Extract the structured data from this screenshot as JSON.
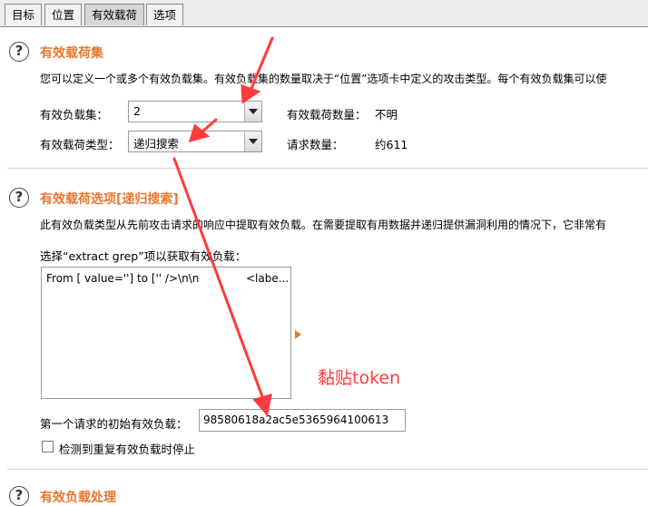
{
  "tabs": [
    {
      "label": "目标"
    },
    {
      "label": "位置"
    },
    {
      "label": "有效载荷"
    },
    {
      "label": "选项"
    }
  ],
  "section1": {
    "title": "有效载荷集",
    "description": "您可以定义一个或多个有效负载集。有效负载集的数量取决于“位置”选项卡中定义的攻击类型。每个有效负载集可以使",
    "payload_set_label": "有效负载集：",
    "payload_set_value": "2",
    "payload_type_label": "有效载荷类型：",
    "payload_type_value": "递归搜索",
    "payload_count_label": "有效载荷数量：",
    "payload_count_value": "不明",
    "request_count_label": "请求数量：",
    "request_count_value": "约611"
  },
  "section2": {
    "title": "有效载荷选项[递归搜索]",
    "description": "此有效负载类型从先前攻击请求的响应中提取有效负载。在需要提取有用数据并递归提供漏洞利用的情况下，它非常有",
    "extract_label": "选择“extract grep”项以获取有效负载：",
    "list_items": [
      {
        "text": "From [ value=''] to ['' />\\n\\n",
        "extra": "<labe..."
      }
    ],
    "initial_payload_label": "第一个请求的初始有效负载：",
    "initial_payload_value": "98580618a2ac5e5365964100613",
    "stop_duplicate_label": "检测到重复有效负载时停止"
  },
  "section3": {
    "title": "有效负载处理"
  },
  "annotation": {
    "text": "黏贴token",
    "color": "#ff3b3b"
  },
  "colors": {
    "accent": "#e8762d",
    "arrow": "#ff3b3b"
  }
}
